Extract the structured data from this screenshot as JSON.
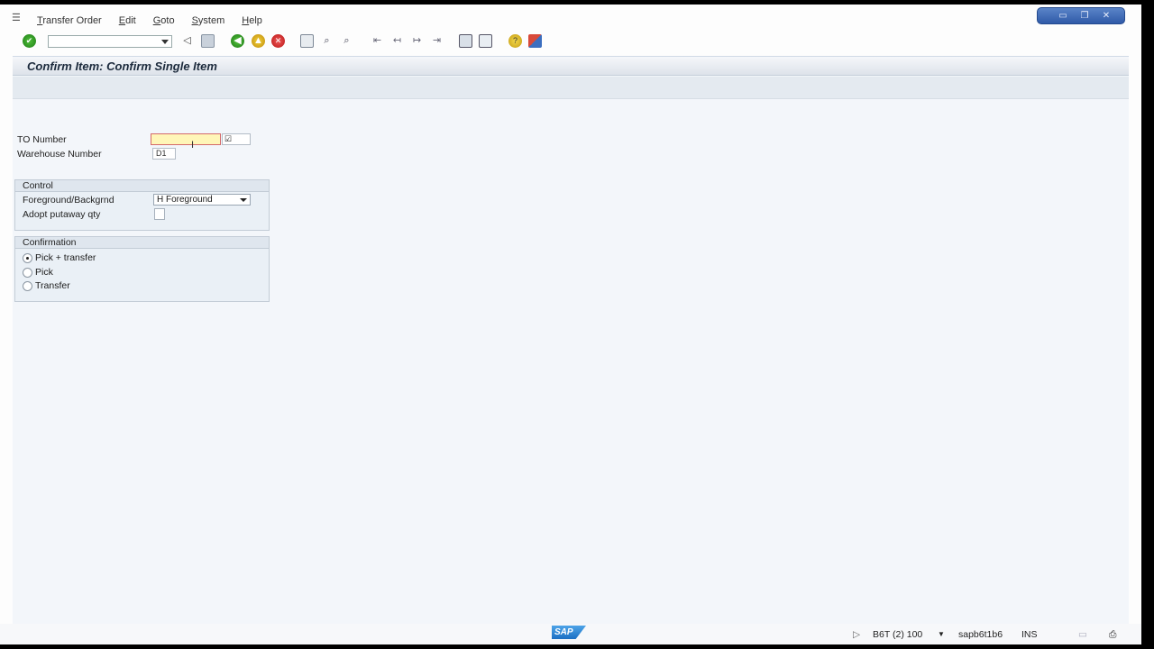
{
  "menu": {
    "items": [
      {
        "label_first": "T",
        "label_rest": "ransfer Order"
      },
      {
        "label_first": "E",
        "label_rest": "dit"
      },
      {
        "label_first": "G",
        "label_rest": "oto"
      },
      {
        "label_first": "S",
        "label_rest": "ystem"
      },
      {
        "label_first": "H",
        "label_rest": "elp"
      }
    ]
  },
  "window_controls": {
    "minimize": "▭",
    "restore": "❐",
    "close": "✕"
  },
  "toolbar": {
    "command_value": "",
    "icons": [
      "enter-icon",
      "back-icon",
      "save-icon",
      "green-back-icon",
      "exit-icon",
      "cancel-icon",
      "print-icon",
      "find-icon",
      "find-next-icon",
      "first-page-icon",
      "previous-page-icon",
      "next-page-icon",
      "last-page-icon",
      "new-session-icon",
      "shortcut-icon",
      "help-icon",
      "customize-layout-icon"
    ]
  },
  "page": {
    "title": "Confirm Item: Confirm Single Item"
  },
  "form": {
    "to_number_label": "TO Number",
    "to_number_value": "",
    "warehouse_label": "Warehouse Number",
    "warehouse_value": "D1"
  },
  "control_group": {
    "title": "Control",
    "fg_label": "Foreground/Backgrnd",
    "fg_value": "H Foreground",
    "adopt_label": "Adopt putaway qty"
  },
  "confirmation_group": {
    "title": "Confirmation",
    "options": [
      {
        "label": "Pick + transfer",
        "selected": true
      },
      {
        "label": "Pick",
        "selected": false
      },
      {
        "label": "Transfer",
        "selected": false
      }
    ]
  },
  "status": {
    "system": "B6T (2) 100",
    "server": "sapb6t1b6",
    "mode": "INS",
    "logo": "SAP"
  }
}
